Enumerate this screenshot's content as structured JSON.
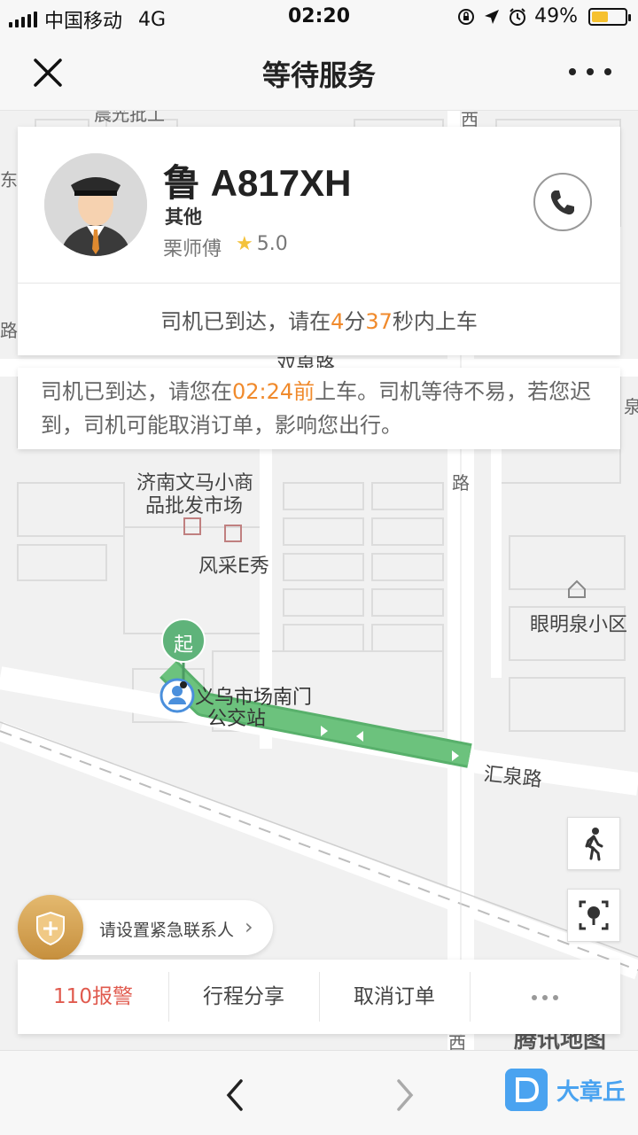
{
  "status_bar": {
    "carrier": "中国移动",
    "network": "4G",
    "time": "02:20",
    "battery": "49%",
    "icons": [
      "signal-icon",
      "lock-rotation-icon",
      "location-arrow-icon",
      "alarm-icon",
      "battery-icon"
    ]
  },
  "nav": {
    "title": "等待服务",
    "close_icon": "close-icon",
    "more_icon": "more-icon"
  },
  "driver": {
    "plate": "鲁 A817XH",
    "car_type": "其他",
    "name": "栗师傅",
    "rating": "5.0",
    "arrive_prefix": "司机已到达，请在",
    "minutes": "4",
    "min_unit": "分",
    "seconds": "37",
    "sec_suffix": "秒内上车"
  },
  "notice": {
    "prefix": "司机已到达，请您在",
    "deadline": "02:24前",
    "rest": "上车。司机等待不易，若您迟到，司机可能取消订单，影响您出行。"
  },
  "map": {
    "labels": {
      "market_a": "济南文马小商",
      "market_b": "品批发市场",
      "fengcai": "风采E秀",
      "yanmingquan": "眼明泉小区",
      "huiquan": "汇泉路",
      "shuangquan": "双泉路",
      "stop_a": "义乌市场南门",
      "stop_b": "公交站",
      "start_marker": "起",
      "east": "东",
      "road_left": "路",
      "road_right": "路",
      "edge_right": "泉",
      "xi": "西",
      "top_a": "晨光批工",
      "top_b": "西路"
    },
    "provider": "腾讯地图"
  },
  "emergency": {
    "label": "请设置紧急联系人"
  },
  "actions": {
    "alarm": "110报警",
    "share": "行程分享",
    "cancel": "取消订单"
  },
  "brand": {
    "name": "大章丘"
  },
  "colors": {
    "accent_orange": "#f08a2c",
    "route_green": "#6abf7b",
    "alarm_red": "#e05a4e",
    "brand_blue": "#4aa3f0"
  }
}
